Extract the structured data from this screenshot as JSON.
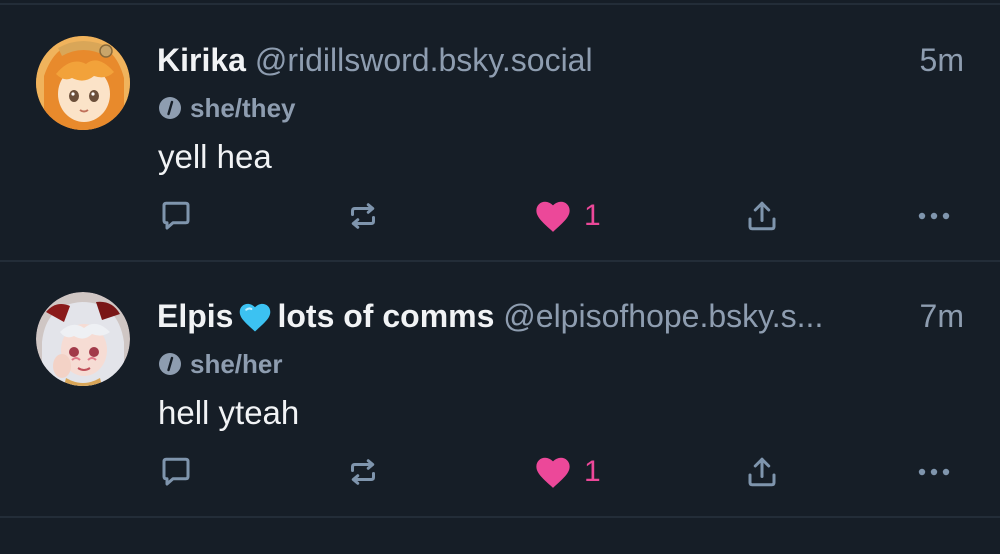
{
  "posts": [
    {
      "display_name": "Kirika",
      "display_name_suffix": "",
      "handle": "@ridillsword.bsky.social",
      "timestamp": "5m",
      "pronouns": "she/they",
      "text": "yell hea",
      "like_count": "1",
      "avatar_icon": "anime-avatar-orange-hair",
      "liked": true
    },
    {
      "display_name": "Elpis",
      "display_name_suffix": "lots of comms",
      "handle": "@elpisofhope.bsky.s...",
      "timestamp": "7m",
      "pronouns": "she/her",
      "text": "hell yteah",
      "like_count": "1",
      "avatar_icon": "anime-avatar-white-hair",
      "liked": true
    }
  ],
  "colors": {
    "background": "#161e27",
    "divider": "#232d38",
    "text": "#f1f3f5",
    "muted": "#8e9db0",
    "icon": "#7f95ad",
    "like": "#ec4899",
    "blue_heart": "#3cc2f2"
  },
  "icons": {
    "reply": "speech-bubble-icon",
    "repost": "repost-arrows-icon",
    "like": "heart-icon",
    "share": "share-upload-icon",
    "more": "more-dots-icon",
    "pronouns": "info-slash-icon",
    "name_emoji": "blue-heart-emoji"
  }
}
